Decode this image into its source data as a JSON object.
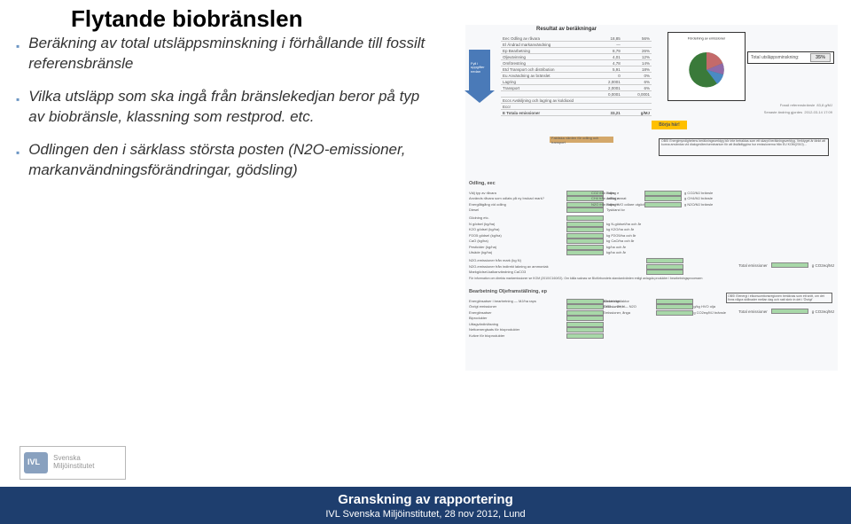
{
  "title": "Flytande biobränslen",
  "bullets": [
    "Beräkning av total utsläppsminskning i förhållande till fossilt referensbränsle",
    "Vilka utsläpp som ska ingå från bränslekedjan beror på typ av biobränsle, klassning som restprod. etc.",
    "Odlingen den i särklass största posten (N2O-emissioner, markanvändningsförändringar, gödsling)"
  ],
  "complex": {
    "result_title": "Resultat av beräkningar",
    "arrow_label": "Fyll i uppgifter nedan",
    "rows": [
      {
        "label": "Eec Odling av råvara",
        "v": "18,85",
        "u": "56%"
      },
      {
        "label": "El Ändrad markanvändning",
        "v": "—",
        "u": ""
      },
      {
        "label": "Ep Bearbetning",
        "v": "8,79",
        "u": "26%"
      },
      {
        "label": "   Oljeutvinning",
        "v": "4,01",
        "u": "12%"
      },
      {
        "label": "   Omförestring",
        "v": "4,78",
        "u": "14%"
      },
      {
        "label": "Etd Transport och distribution",
        "v": "5,91",
        "u": "18%"
      },
      {
        "label": "Eu Användning av bränslet",
        "v": "0",
        "u": "0%"
      },
      {
        "label": "   Lagring",
        "v": "2,0001",
        "u": "6%"
      },
      {
        "label": "   Transport",
        "v": "2,0001",
        "u": "6%"
      },
      {
        "label": "   ",
        "v": "0,0001",
        "u": "0,0001"
      },
      {
        "label": "Eccs Avskiljning och lagring av koldioxid",
        "v": "",
        "u": ""
      },
      {
        "label": "Eccr",
        "v": "",
        "u": ""
      },
      {
        "label": "E Totala emissioner",
        "v": "33,21",
        "u": "g/MJ"
      }
    ],
    "pie_label": "Fördelning av emissioner",
    "total_pct_label": "Total utsläppsminskning:",
    "total_pct": "35%",
    "borja": "Börja här!",
    "brown": "Faktiska värden för odling och transport",
    "obs": "OBS! Energimyndighetens beräkningsverktyg bör inte betraktas som ett skarpt beräkningsverktyg. Verktyget är tänkt att kunna användas vid dialogmöten/seminarium för att åskådliggöra hur emissionerna från EU KOM(2010)…",
    "right_meta": [
      {
        "l": "Fossil referensbränsle",
        "v": "83,8 g/MJ"
      },
      {
        "l": "Senaste ändring gjordes",
        "v": "2012-03-14 17:09"
      }
    ],
    "odling_title": "Odling, eec",
    "odling_left": [
      "Välj typ av råvara",
      "Används råvara som odlats på ny brukad mark?",
      "Energiåtgång vid odling",
      "Diesel"
    ],
    "odling_left_opts": [
      "Raps",
      "Ja/Nej annat"
    ],
    "odling_left_vals": [
      "Raps HVO odlare utgöds",
      "Tyskland kv"
    ],
    "odling_right": [
      {
        "l": "CO2 från odling e",
        "v": "g CO2/MJ bränsle"
      },
      {
        "l": "CH4 från odling e",
        "v": "g CH4/MJ bränsle"
      },
      {
        "l": "N2O från odling e",
        "v": "g N2O/MJ bränsle"
      }
    ],
    "odling_mid": [
      {
        "l": "Gödning etc.",
        "v": ""
      },
      {
        "l": "N gödsel (kg/ha)",
        "v": "kg N-gödsel/ha och år"
      },
      {
        "l": "K2O gödsel (kg/ha)",
        "v": "kg K2O/ha och år"
      },
      {
        "l": "P2O5 gödsel (kg/ha)",
        "v": "kg P2O5/ha och år"
      },
      {
        "l": "CaO (kg/ha)",
        "v": "kg CaO/ha och år"
      },
      {
        "l": "Pesticider (kg/ha)",
        "v": "kg/ha och år"
      },
      {
        "l": "Utsäde (kg/ha)",
        "v": "kg/ha och år"
      }
    ],
    "odling_n2o": [
      "N2O-emissioner från mark (kg N)",
      "N2O-emissioner från indirekt lakning av ammoniak",
      "Markgödsel-kalkanvändning CaCO3"
    ],
    "odling_note": "För information om direkta markemissioner se KOM (2010/C160/02). Om källa saknas se Bioförbundets standardvärden enligt anlagda produkter i bearbetningsprocessen",
    "odling_total": {
      "l": "Total emissioner",
      "v": "g CO2eq/MJ"
    },
    "bear_title": "Bearbetning Oljeframställning, ep",
    "bear_rows": [
      {
        "l": "Energiinsatser i bearbetning — MJ/ha raps",
        "sub": "Elektricitet"
      },
      {
        "l": "Övrigt emissioner",
        "sub": "CO2 —  CH4 —  N2O"
      },
      {
        "l": "Energiinsatser",
        "sub": ""
      },
      {
        "l": "Biprodukter",
        "sub": ""
      },
      {
        "l": "Uttagvärdinläsning",
        "sub": ""
      },
      {
        "l": "Nettoenergisats för bioprodukter",
        "sub": ""
      },
      {
        "l": "Kväve för bioprodukter",
        "sub": ""
      }
    ],
    "bear_right": [
      {
        "l": "Allokeringsfaktor",
        "v": ""
      },
      {
        "l": "Emissioner, el",
        "v": "g/kg HVO olja"
      },
      {
        "l": "Emissioner, ånga",
        "v": "g CO2eq/MJ bränsle"
      }
    ],
    "bear_note": "OBS! Elenergi i elkonsumtionsregionen beräknas som ett snitt, om det finns några skillnader mellan dag och natt skriv in det i 'Övrigt'",
    "bear_total": {
      "l": "Total emissioner",
      "v": "g CO2eq/MJ"
    }
  },
  "chart_data": {
    "type": "pie",
    "title": "Fördelning av emissioner",
    "series": [
      {
        "name": "Eec",
        "value": 56,
        "color": "#3a7a3a"
      },
      {
        "name": "Ep (oljeutvinning)",
        "value": 12,
        "color": "#4a8ac4"
      },
      {
        "name": "Ep (omförestring)",
        "value": 14,
        "color": "#8f6aa8"
      },
      {
        "name": "Etd",
        "value": 18,
        "color": "#c46a6a"
      }
    ]
  },
  "footer": {
    "title": "Granskning av rapportering",
    "sub": "IVL Svenska Miljöinstitutet, 28 nov 2012, Lund"
  },
  "logo_text": "Svenska Miljöinstitutet"
}
